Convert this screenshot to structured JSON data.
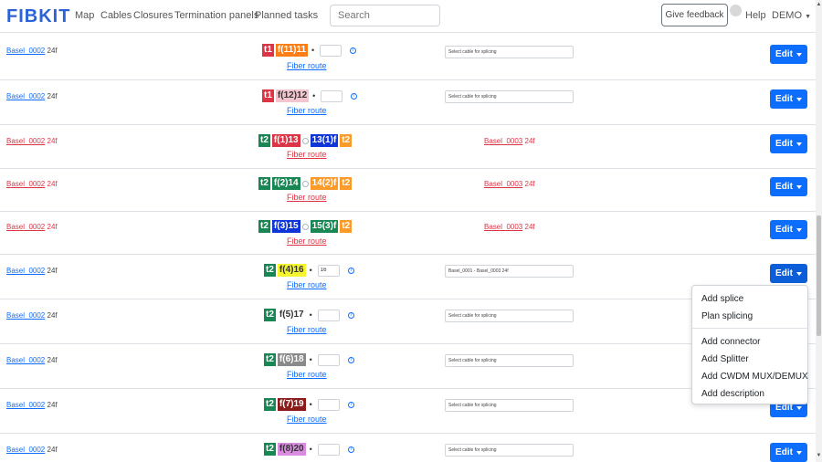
{
  "navbar": {
    "brand": "FIBKIT",
    "links": [
      "Map",
      "Cables",
      "Closures",
      "Termination panels",
      "Planned tasks"
    ],
    "search_placeholder": "Search",
    "feedback_label": "Give feedback",
    "help_label": "Help",
    "user_label": "DEMO"
  },
  "common": {
    "fiber_route_label": "Fiber route",
    "edit_label": "Edit",
    "info_glyph": "i"
  },
  "rows": [
    {
      "left_cable": "Basel_0002",
      "left_size": "24f",
      "style": "blue",
      "tube": "t1",
      "tube_color": "#dc3545",
      "fiber": "f(11)11",
      "fiber_color": "#fd7e14",
      "fiber_text_color": "#ffffff",
      "splice_value": "",
      "select_text": "Select cable for splicing"
    },
    {
      "left_cable": "Basel_0002",
      "left_size": "24f",
      "style": "blue",
      "tube": "t1",
      "tube_color": "#dc3545",
      "fiber": "f(12)12",
      "fiber_color": "#f3c6cf",
      "fiber_text_color": "#333333",
      "splice_value": "",
      "select_text": "Select cable for splicing"
    },
    {
      "left_cable": "Basel_0002",
      "left_size": "24f",
      "style": "red",
      "tube": "t2",
      "tube_color": "#198754",
      "fiber": "f(1)13",
      "fiber_color": "#dc3545",
      "fiber_text_color": "#ffffff",
      "right_fiber": "13(1)f",
      "right_fiber_color": "#0d35d8",
      "right_tube": "t2",
      "right_tube_color": "#fd9b2a",
      "right_cable": "Basel_0003",
      "right_size": "24f"
    },
    {
      "left_cable": "Basel_0002",
      "left_size": "24f",
      "style": "red",
      "tube": "t2",
      "tube_color": "#198754",
      "fiber": "f(2)14",
      "fiber_color": "#198754",
      "fiber_text_color": "#ffffff",
      "right_fiber": "14(2)f",
      "right_fiber_color": "#fd9b2a",
      "right_tube": "t2",
      "right_tube_color": "#fd9b2a",
      "right_cable": "Basel_0003",
      "right_size": "24f"
    },
    {
      "left_cable": "Basel_0002",
      "left_size": "24f",
      "style": "red",
      "tube": "t2",
      "tube_color": "#198754",
      "fiber": "f(3)15",
      "fiber_color": "#0d35d8",
      "fiber_text_color": "#ffffff",
      "right_fiber": "15(3)f",
      "right_fiber_color": "#198754",
      "right_tube": "t2",
      "right_tube_color": "#fd9b2a",
      "right_cable": "Basel_0003",
      "right_size": "24f"
    },
    {
      "left_cable": "Basel_0002",
      "left_size": "24f",
      "style": "blue",
      "tube": "t2",
      "tube_color": "#198754",
      "fiber": "f(4)16",
      "fiber_color": "#f5f530",
      "fiber_text_color": "#333333",
      "splice_value": "16",
      "select_text": "Basel_0001 - Basel_0003 24f"
    },
    {
      "left_cable": "Basel_0002",
      "left_size": "24f",
      "style": "blue",
      "tube": "t2",
      "tube_color": "#198754",
      "fiber": "f(5)17",
      "fiber_color": "#ffffff",
      "fiber_text_color": "#333333",
      "splice_value": "",
      "select_text": "Select cable for splicing"
    },
    {
      "left_cable": "Basel_0002",
      "left_size": "24f",
      "style": "blue",
      "tube": "t2",
      "tube_color": "#198754",
      "fiber": "f(6)18",
      "fiber_color": "#8a8a8a",
      "fiber_text_color": "#ffffff",
      "splice_value": "",
      "select_text": "Select cable for splicing"
    },
    {
      "left_cable": "Basel_0002",
      "left_size": "24f",
      "style": "blue",
      "tube": "t2",
      "tube_color": "#198754",
      "fiber": "f(7)19",
      "fiber_color": "#8b1a1a",
      "fiber_text_color": "#ffffff",
      "splice_value": "",
      "select_text": "Select cable for splicing"
    },
    {
      "left_cable": "Basel_0002",
      "left_size": "24f",
      "style": "blue",
      "tube": "t2",
      "tube_color": "#198754",
      "fiber": "f(8)20",
      "fiber_color": "#d98be0",
      "fiber_text_color": "#333333",
      "splice_value": "",
      "select_text": "Select cable for splicing"
    }
  ],
  "dropdown": {
    "group1": [
      "Add splice",
      "Plan splicing"
    ],
    "group2": [
      "Add connector",
      "Add Splitter",
      "Add CWDM MUX/DEMUX",
      "Add description"
    ]
  }
}
